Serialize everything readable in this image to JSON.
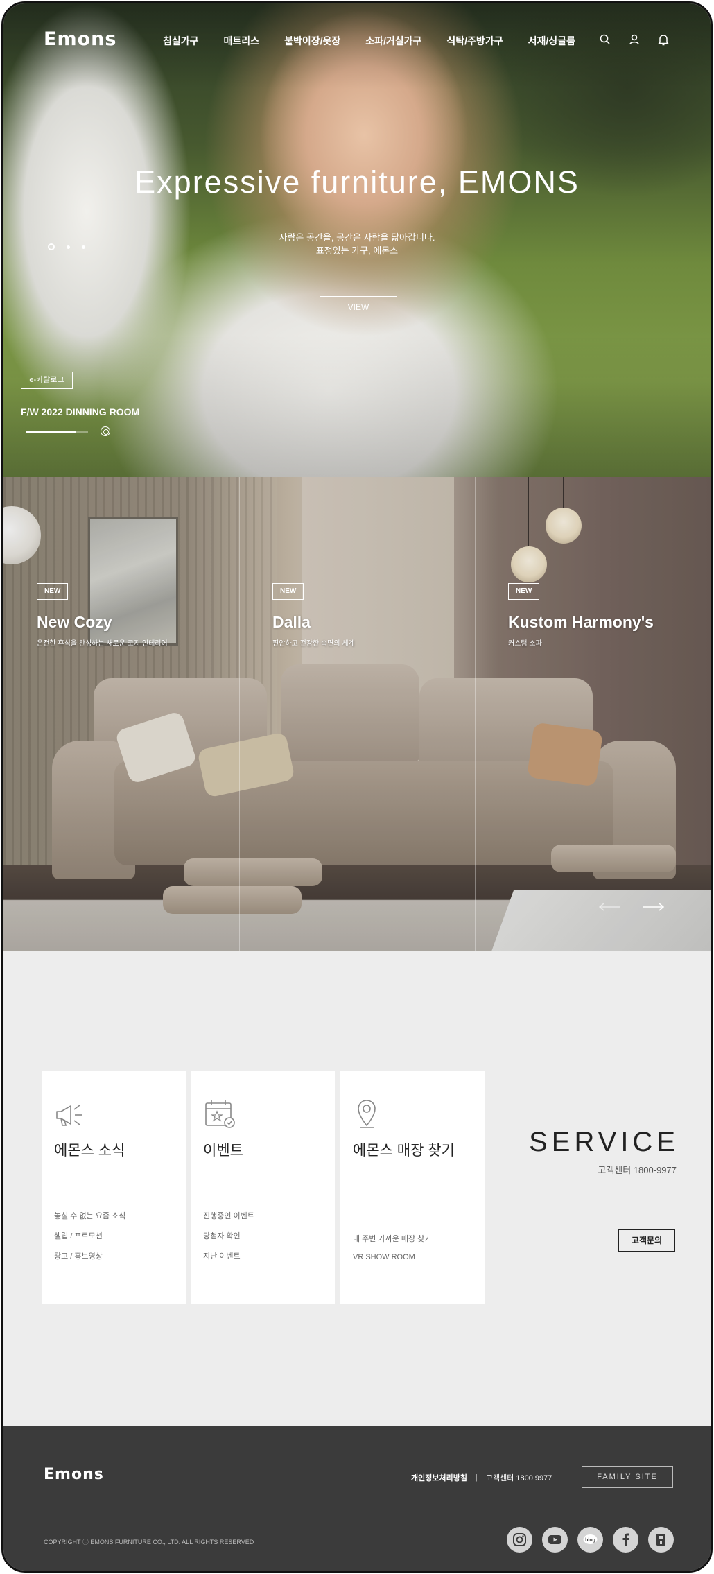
{
  "brand": {
    "logo_text": "Emons"
  },
  "nav": {
    "menu": [
      "침실가구",
      "매트리스",
      "붙박이장/옷장",
      "소파/거실가구",
      "식탁/주방가구",
      "서재/싱글룸"
    ],
    "icons": [
      "search-icon",
      "user-icon",
      "bell-icon"
    ]
  },
  "hero": {
    "title": "Expressive furniture, EMONS",
    "subtitle_line1": "사람은 공간을, 공간은 사람을 닮아갑니다.",
    "subtitle_line2": "표정있는 가구, 에몬스",
    "cta": "VIEW",
    "catalog_button": "e-카탈로그",
    "caption": "F/W 2022 DINNING ROOM",
    "slide_count": 3,
    "active_slide": 1,
    "progress": 0.8
  },
  "products": {
    "items": [
      {
        "badge": "NEW",
        "name": "New Cozy",
        "desc": "온전한 휴식을 완성하는 새로운 코지 인테리어"
      },
      {
        "badge": "NEW",
        "name": "Dalla",
        "desc": "편안하고 건강한 숙면의 세계"
      },
      {
        "badge": "NEW",
        "name": "Kustom Harmony's",
        "desc": "커스텀 소파"
      }
    ],
    "arrows": [
      "arrow-left-icon",
      "arrow-right-icon"
    ]
  },
  "service": {
    "title": "SERVICE",
    "phone": "고객센터 1800-9977",
    "button": "고객문의",
    "cards": [
      {
        "icon": "megaphone-icon",
        "title": "에몬스 소식",
        "links": [
          "놓칠 수 없는 요즘 소식",
          "셀럽 / 프로모션",
          "광고 / 홍보영상"
        ]
      },
      {
        "icon": "calendar-icon",
        "title": "이벤트",
        "links": [
          "진행중인 이벤트",
          "당첨자 확인",
          "지난 이벤트"
        ]
      },
      {
        "icon": "location-pin-icon",
        "title": "에몬스 매장 찾기",
        "links": [
          "내 주변 가까운 매장 찾기",
          "VR SHOW ROOM"
        ]
      }
    ]
  },
  "footer": {
    "logo_text": "Emons",
    "privacy": "개인정보처리방침",
    "separator": "|",
    "phone": "고객센터 1800 9977",
    "family_site": "FAMILY SITE",
    "copyright": "COPYRIGHT ⓒ EMONS FURNITURE CO., LTD. ALL RIGHTS RESERVED",
    "social": [
      "instagram-icon",
      "youtube-icon",
      "blog-icon",
      "facebook-icon",
      "store-icon"
    ],
    "blog_label": "blog"
  },
  "colors": {
    "footer_bg": "#3b3b3b",
    "service_bg": "#ededed",
    "text_dark": "#222222"
  }
}
